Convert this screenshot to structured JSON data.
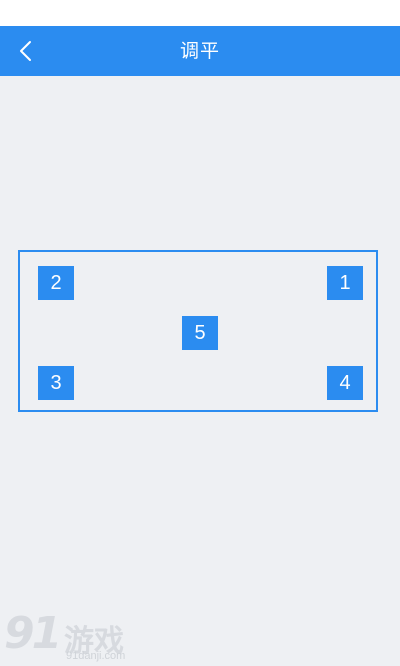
{
  "header": {
    "title": "调平",
    "back_icon": "chevron-left-icon",
    "background_color": "#2b8cf0"
  },
  "leveling": {
    "frame_color": "#2b8cf0",
    "points": [
      {
        "id": "2",
        "label": "2"
      },
      {
        "id": "1",
        "label": "1"
      },
      {
        "id": "5",
        "label": "5"
      },
      {
        "id": "3",
        "label": "3"
      },
      {
        "id": "4",
        "label": "4"
      }
    ]
  },
  "watermark": {
    "logo_number": "91",
    "logo_text": "游戏",
    "domain": "91danji.com"
  }
}
